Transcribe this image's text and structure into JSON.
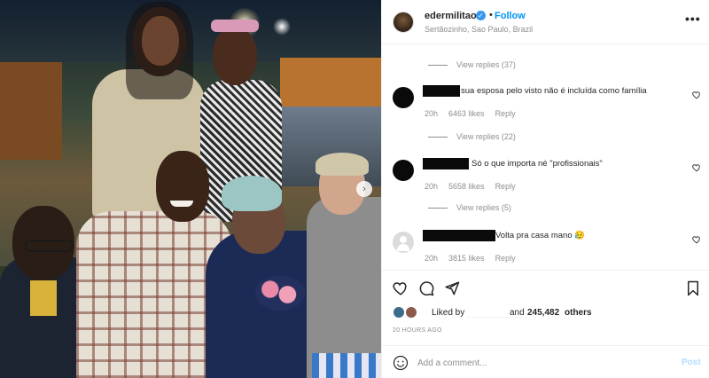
{
  "post": {
    "username": "edermilitao",
    "follow_label": "Follow",
    "separator": "•",
    "location": "Sertãozinho, Sao Paulo, Brazil",
    "more_label": "•••"
  },
  "comments": {
    "top_view_replies": "View replies (37)",
    "items": [
      {
        "text": "sua esposa pelo visto não é incluída como família",
        "time": "20h",
        "likes": "6463 likes",
        "reply": "Reply",
        "view_replies": "View replies (22)"
      },
      {
        "text": "Só o que importa né \"profissionais\"",
        "time": "20h",
        "likes": "5658 likes",
        "reply": "Reply",
        "view_replies": "View replies (5)"
      },
      {
        "text": "Volta pra casa mano 😥",
        "time": "20h",
        "likes": "3815 likes",
        "reply": "Reply"
      }
    ]
  },
  "likes": {
    "liked_by": "Liked by",
    "and": "and",
    "count": "245,482",
    "others": "others"
  },
  "timestamp": "20 HOURS AGO",
  "add_comment": {
    "placeholder": "Add a comment...",
    "post_label": "Post"
  },
  "icons": {
    "verified": "verified-badge-icon",
    "heart": "heart-icon",
    "comment": "comment-icon",
    "share": "share-icon",
    "bookmark": "bookmark-icon",
    "emoji": "emoji-icon",
    "next": "chevron-right-icon"
  },
  "colors": {
    "follow": "#0095f6",
    "verified": "#3897f0",
    "secondary_text": "#8e8e8e",
    "post_disabled": "#b3dbff"
  }
}
